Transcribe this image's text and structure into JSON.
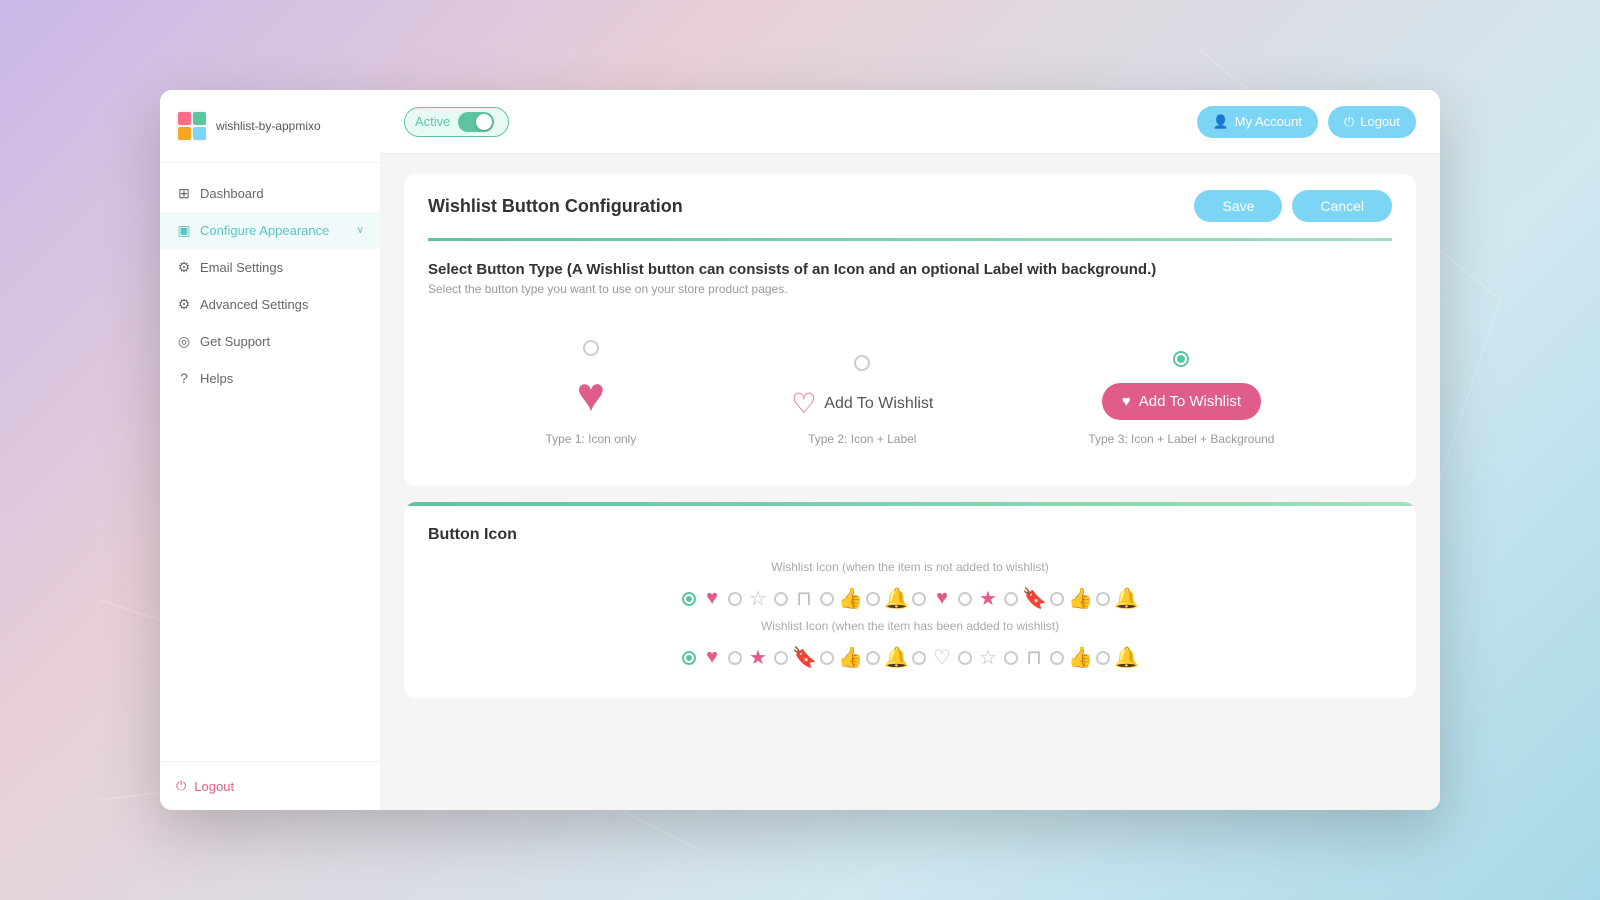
{
  "app": {
    "logo_text": "wishlist-by-appmixo",
    "active_label": "Active",
    "toggle_state": true
  },
  "header": {
    "my_account_label": "My Account",
    "logout_label": "Logout"
  },
  "sidebar": {
    "items": [
      {
        "id": "dashboard",
        "label": "Dashboard",
        "icon": "⊞",
        "active": false
      },
      {
        "id": "configure-appearance",
        "label": "Configure Appearance",
        "icon": "▣",
        "active": true
      },
      {
        "id": "email-settings",
        "label": "Email Settings",
        "icon": "⚙",
        "active": false
      },
      {
        "id": "advanced-settings",
        "label": "Advanced Settings",
        "icon": "⚙",
        "active": false
      },
      {
        "id": "get-support",
        "label": "Get Support",
        "icon": "◎",
        "active": false
      },
      {
        "id": "helps",
        "label": "Helps",
        "icon": "?",
        "active": false
      }
    ],
    "logout_label": "Logout"
  },
  "main": {
    "page_title": "Wishlist Button Configuration",
    "save_label": "Save",
    "cancel_label": "Cancel",
    "button_type_section": {
      "title": "Select Button Type (A Wishlist button can consists of an Icon and an optional Label with background.)",
      "subtitle": "Select the button type you want to use on your store product pages.",
      "types": [
        {
          "id": "type1",
          "label": "Type 1: Icon only",
          "selected": false
        },
        {
          "id": "type2",
          "label": "Type 2: Icon + Label",
          "selected": false
        },
        {
          "id": "type3",
          "label": "Type 3: Icon + Label + Background",
          "selected": true
        }
      ],
      "add_to_wishlist_label": "Add To Wishlist"
    },
    "button_icon_section": {
      "title": "Button Icon",
      "wishlist_icon_inactive_label": "Wishlist Icon (when the item is not added to wishlist)",
      "wishlist_icon_active_label": "Wishlist Icon (when the item has been added to wishlist)",
      "icons_inactive": [
        {
          "id": "heart",
          "symbol": "♡",
          "selected": true,
          "filled": true
        },
        {
          "id": "star",
          "symbol": "☆",
          "selected": false
        },
        {
          "id": "bookmark",
          "symbol": "🏷",
          "selected": false
        },
        {
          "id": "thumb",
          "symbol": "👍",
          "selected": false
        },
        {
          "id": "bell",
          "symbol": "🔔",
          "selected": false
        },
        {
          "id": "heart-filled",
          "symbol": "♥",
          "selected": false
        },
        {
          "id": "star-filled",
          "symbol": "★",
          "selected": false
        },
        {
          "id": "bookmark-filled",
          "symbol": "🔖",
          "selected": false
        },
        {
          "id": "thumb-filled",
          "symbol": "👍",
          "selected": false
        },
        {
          "id": "bell-filled",
          "symbol": "🔔",
          "selected": false
        }
      ],
      "icons_active": [
        {
          "id": "heart",
          "symbol": "♥",
          "selected": true,
          "filled": true
        },
        {
          "id": "star-filled",
          "symbol": "★",
          "selected": false
        },
        {
          "id": "bookmark-filled",
          "symbol": "🔖",
          "selected": false
        },
        {
          "id": "thumb-filled",
          "symbol": "👍",
          "selected": false
        },
        {
          "id": "bell-filled",
          "symbol": "🔔",
          "selected": false
        },
        {
          "id": "heart-outline",
          "symbol": "♡",
          "selected": false
        },
        {
          "id": "star-outline",
          "symbol": "☆",
          "selected": false
        },
        {
          "id": "bookmark-outline",
          "symbol": "🏷",
          "selected": false
        },
        {
          "id": "thumb-outline",
          "symbol": "👍",
          "selected": false
        },
        {
          "id": "bell-outline",
          "symbol": "🔔",
          "selected": false
        }
      ]
    }
  }
}
